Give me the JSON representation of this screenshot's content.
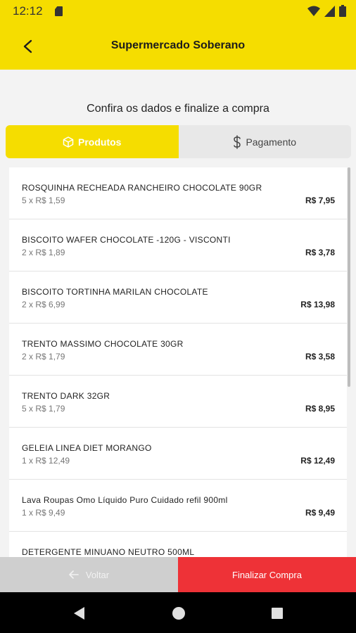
{
  "status": {
    "time": "12:12"
  },
  "appbar": {
    "title": "Supermercado Soberano"
  },
  "subtitle": "Confira os dados e finalize a compra",
  "tabs": [
    {
      "label": "Produtos",
      "icon": "box-icon",
      "active": true
    },
    {
      "label": "Pagamento",
      "icon": "dollar-icon",
      "active": false
    }
  ],
  "items": [
    {
      "name": "ROSQUINHA RECHEADA RANCHEIRO CHOCOLATE 90GR",
      "qty": "5 x R$ 1,59",
      "total": "R$ 7,95"
    },
    {
      "name": "BISCOITO WAFER CHOCOLATE -120G - VISCONTI",
      "qty": "2 x R$ 1,89",
      "total": "R$ 3,78"
    },
    {
      "name": "BISCOITO TORTINHA MARILAN CHOCOLATE",
      "qty": "2 x R$ 6,99",
      "total": "R$ 13,98"
    },
    {
      "name": "TRENTO MASSIMO CHOCOLATE 30GR",
      "qty": "2 x R$ 1,79",
      "total": "R$ 3,58"
    },
    {
      "name": "TRENTO DARK 32GR",
      "qty": "5 x R$ 1,79",
      "total": "R$ 8,95"
    },
    {
      "name": "GELEIA LINEA DIET MORANGO",
      "qty": "1 x R$ 12,49",
      "total": "R$ 12,49"
    },
    {
      "name": "Lava Roupas Omo Líquido Puro Cuidado refil 900ml",
      "qty": "1 x R$ 9,49",
      "total": "R$ 9,49"
    },
    {
      "name": "DETERGENTE MINUANO NEUTRO 500ML",
      "qty": "",
      "total": ""
    }
  ],
  "buttons": {
    "back_label": "Voltar",
    "finish_label": "Finalizar Compra"
  },
  "colors": {
    "brand_yellow": "#f5dd00",
    "finish_red": "#ee3237",
    "back_gray": "#cfcfcf"
  }
}
